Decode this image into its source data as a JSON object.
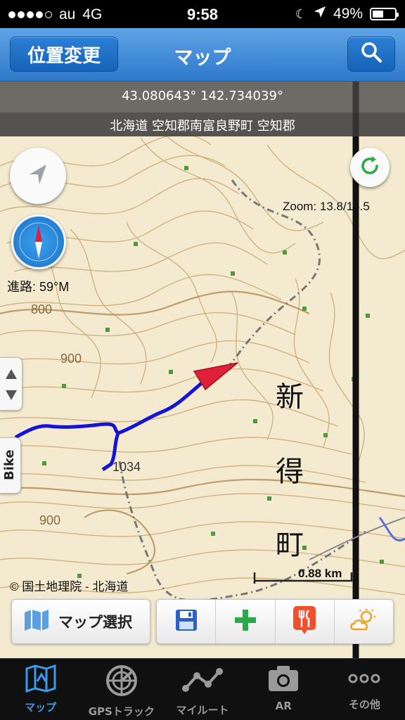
{
  "status": {
    "carrier": "au",
    "network": "4G",
    "time": "9:58",
    "battery": "49%",
    "battery_level": 0.49,
    "signal_dots_filled": 4
  },
  "nav": {
    "left_button": "位置変更",
    "title": "マップ",
    "right_icon": "search-icon"
  },
  "map": {
    "coordinates": "43.080643° 142.734039°",
    "address": "北海道 空知郡南富良野町 空知郡",
    "zoom": "Zoom: 13.8/15.5",
    "heading": "進路: 59°M",
    "copyright": "© 国土地理院 - 北海道",
    "scale": "0.88 km",
    "place_name": [
      "新",
      "得",
      "町"
    ],
    "elevations": [
      "800",
      "900",
      "1034",
      "900"
    ],
    "bike_tab": "Bike"
  },
  "actions": {
    "map_select": "マップ選択",
    "tools": [
      "save-icon",
      "add-icon",
      "restaurant-icon",
      "weather-icon"
    ]
  },
  "tabs": [
    {
      "label": "マップ",
      "icon": "map-icon",
      "active": true
    },
    {
      "label": "GPSトラック",
      "icon": "radar-icon",
      "active": false
    },
    {
      "label": "マイルート",
      "icon": "route-icon",
      "active": false
    },
    {
      "label": "AR",
      "icon": "camera-icon",
      "active": false
    },
    {
      "label": "その他",
      "icon": "more-icon",
      "active": false
    }
  ],
  "colors": {
    "accent": "#2f79cb",
    "track": "#1414d8",
    "position_arrow": "#e0203a",
    "tab_active": "#3c9af0"
  }
}
